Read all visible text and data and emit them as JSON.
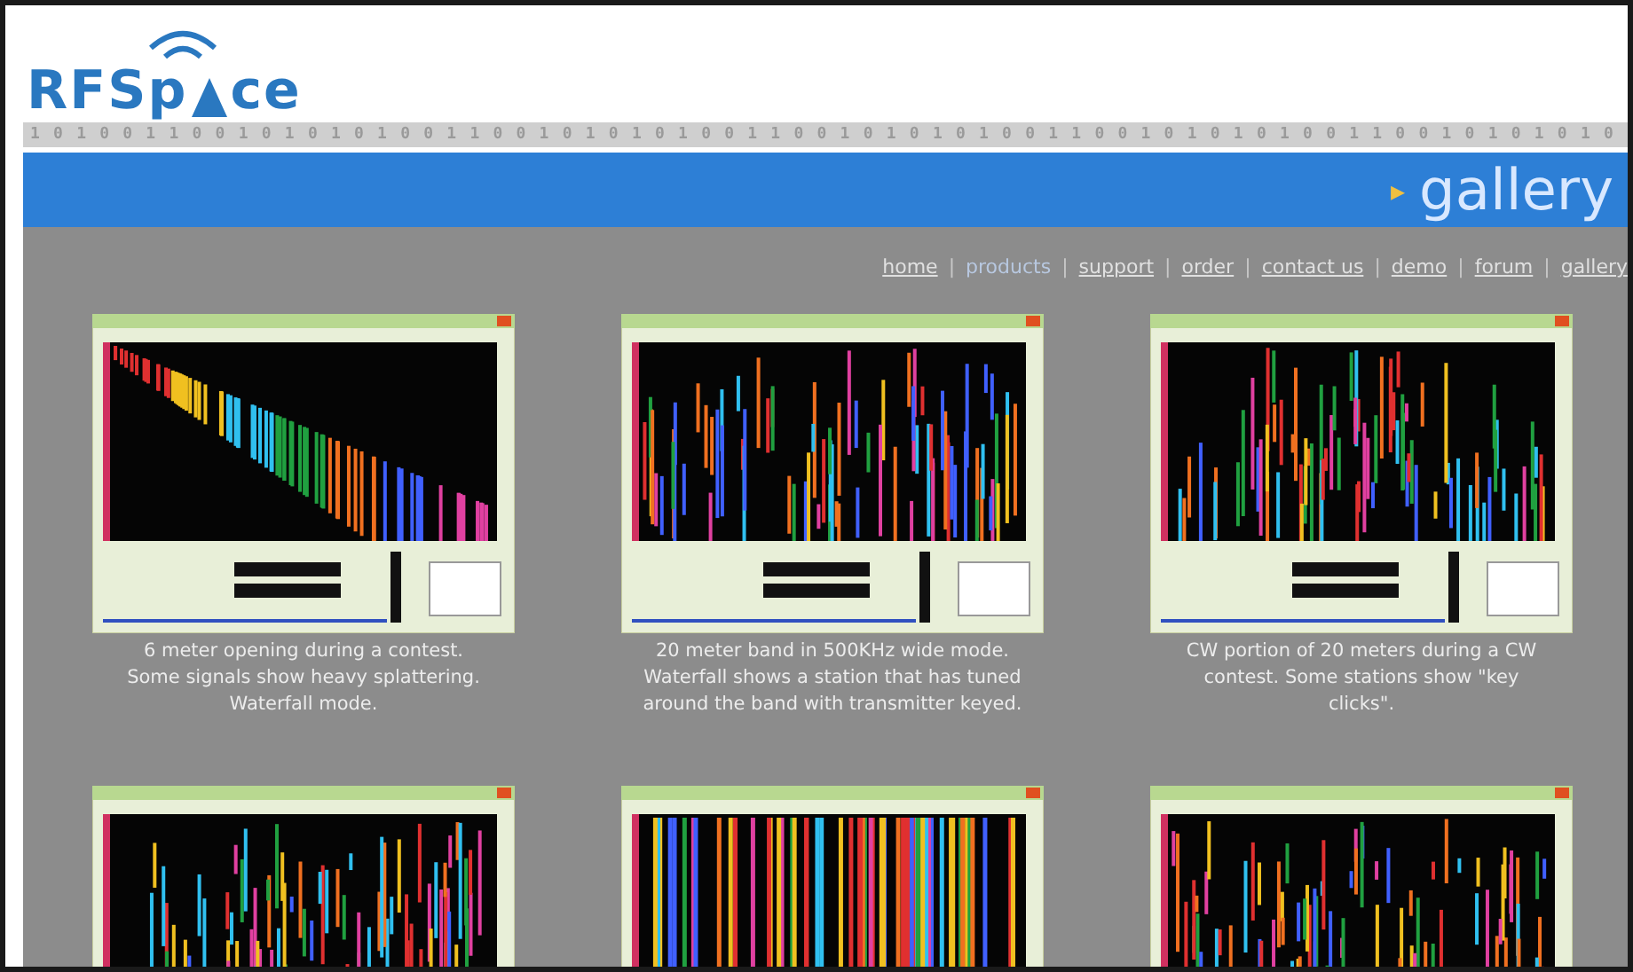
{
  "logo": {
    "before": "RFSp",
    "after": "ce"
  },
  "binary_strip": "1 0 1 0 0 1 1 0 0 1 0 1 0 1 0 1 0 0 1 1 0 0 1 0 1 0 1 0 1 0 0 1 1 0 0 1 0 1 0 1 0 1 0 0 1 1 0 0 1 0 1 0 1 0 1 0 0 1 1 0 0 1 0 1 0 1 0 1 0",
  "banner": {
    "arrow": "▸",
    "title": "gallery"
  },
  "nav": [
    {
      "label": "home",
      "selected": false
    },
    {
      "label": "products",
      "selected": true
    },
    {
      "label": "support",
      "selected": false
    },
    {
      "label": "order",
      "selected": false
    },
    {
      "label": "contact us",
      "selected": false
    },
    {
      "label": "demo",
      "selected": false
    },
    {
      "label": "forum",
      "selected": false
    },
    {
      "label": "gallery",
      "selected": false
    }
  ],
  "nav_separator": "|",
  "gallery": [
    {
      "kind": "waterfall",
      "caption": "6 meter opening during a contest.\nSome signals show heavy splattering.\nWaterfall mode."
    },
    {
      "kind": "waterfall",
      "caption": "20 meter band in 500KHz wide mode.\nWaterfall shows a station that has tuned\naround the band with transmitter keyed."
    },
    {
      "kind": "waterfall",
      "caption": "CW portion of 20 meters during a CW\ncontest. Some stations show \"key\nclicks\"."
    },
    {
      "kind": "waterfall"
    },
    {
      "kind": "striped"
    },
    {
      "kind": "waterfall"
    }
  ]
}
